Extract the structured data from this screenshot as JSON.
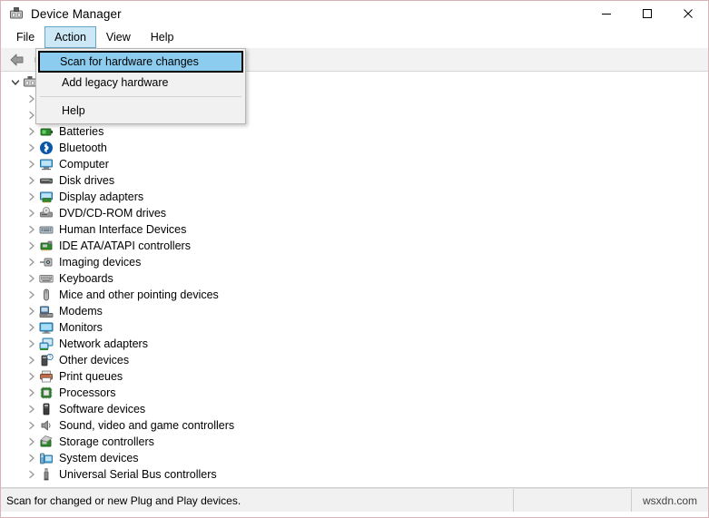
{
  "window": {
    "title": "Device Manager",
    "title_icon": "device-manager-icon"
  },
  "window_buttons": {
    "minimize": "—",
    "maximize": "□",
    "close": "✕"
  },
  "menubar": {
    "items": [
      {
        "label": "File",
        "open": false
      },
      {
        "label": "Action",
        "open": true
      },
      {
        "label": "View",
        "open": false
      },
      {
        "label": "Help",
        "open": false
      }
    ]
  },
  "toolbar": {
    "buttons": [
      {
        "name": "back-button",
        "icon": "back-arrow-icon"
      },
      {
        "name": "forward-button",
        "icon": "forward-arrow-icon"
      }
    ]
  },
  "action_menu": {
    "items": [
      {
        "label": "Scan for hardware changes",
        "selected": true,
        "separator_after": false
      },
      {
        "label": "Add legacy hardware",
        "selected": false,
        "separator_after": true
      },
      {
        "label": "Help",
        "selected": false,
        "separator_after": false
      }
    ]
  },
  "tree": {
    "root": {
      "label": "",
      "icon": "computer-root-icon",
      "expanded": true
    },
    "items": [
      {
        "label": "",
        "icon": "generic-icon",
        "level": 1
      },
      {
        "label": "",
        "icon": "generic-icon",
        "level": 1
      },
      {
        "label": "Batteries",
        "icon": "battery-icon",
        "level": 1
      },
      {
        "label": "Bluetooth",
        "icon": "bluetooth-icon",
        "level": 1
      },
      {
        "label": "Computer",
        "icon": "computer-icon",
        "level": 1
      },
      {
        "label": "Disk drives",
        "icon": "disk-drive-icon",
        "level": 1
      },
      {
        "label": "Display adapters",
        "icon": "display-adapter-icon",
        "level": 1
      },
      {
        "label": "DVD/CD-ROM drives",
        "icon": "dvd-drive-icon",
        "level": 1
      },
      {
        "label": "Human Interface Devices",
        "icon": "hid-icon",
        "level": 1
      },
      {
        "label": "IDE ATA/ATAPI controllers",
        "icon": "ide-controller-icon",
        "level": 1
      },
      {
        "label": "Imaging devices",
        "icon": "imaging-device-icon",
        "level": 1
      },
      {
        "label": "Keyboards",
        "icon": "keyboard-icon",
        "level": 1
      },
      {
        "label": "Mice and other pointing devices",
        "icon": "mouse-icon",
        "level": 1
      },
      {
        "label": "Modems",
        "icon": "modem-icon",
        "level": 1
      },
      {
        "label": "Monitors",
        "icon": "monitor-icon",
        "level": 1
      },
      {
        "label": "Network adapters",
        "icon": "network-adapter-icon",
        "level": 1
      },
      {
        "label": "Other devices",
        "icon": "other-device-icon",
        "level": 1
      },
      {
        "label": "Print queues",
        "icon": "printer-icon",
        "level": 1
      },
      {
        "label": "Processors",
        "icon": "processor-icon",
        "level": 1
      },
      {
        "label": "Software devices",
        "icon": "software-device-icon",
        "level": 1
      },
      {
        "label": "Sound, video and game controllers",
        "icon": "sound-controller-icon",
        "level": 1
      },
      {
        "label": "Storage controllers",
        "icon": "storage-controller-icon",
        "level": 1
      },
      {
        "label": "System devices",
        "icon": "system-device-icon",
        "level": 1
      },
      {
        "label": "Universal Serial Bus controllers",
        "icon": "usb-controller-icon",
        "level": 1
      }
    ]
  },
  "statusbar": {
    "message": "Scan for changed or new Plug and Play devices.",
    "watermark": "wsxdn.com"
  },
  "colors": {
    "menu_highlight": "#cce8f6",
    "menu_highlight_border": "#66a7c5",
    "selection_blue": "#8ccdef",
    "window_border": "#d9b3b8",
    "toolbar_bg": "#f2f2f2",
    "statusbar_bg": "#f1f1f1"
  }
}
